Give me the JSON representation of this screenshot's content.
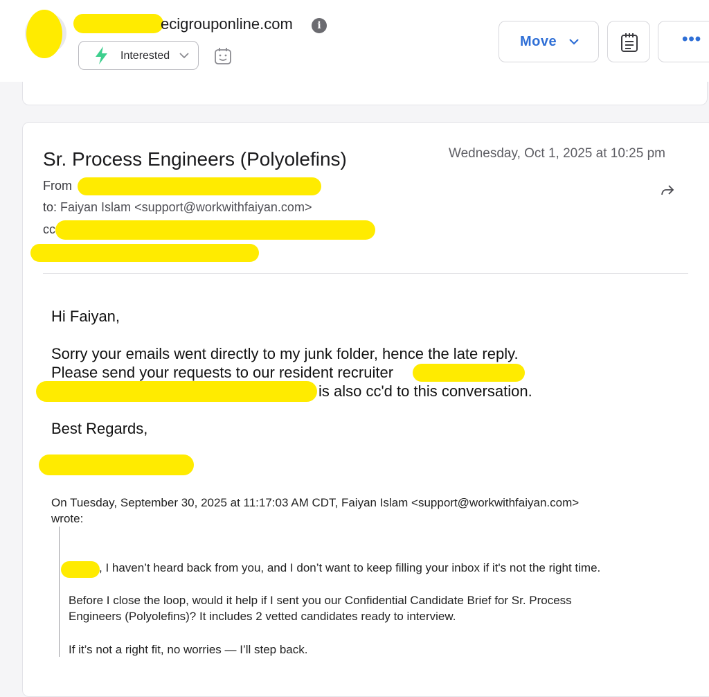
{
  "header": {
    "sender_domain": "ecigrouponline.com",
    "info_icon": "info-icon",
    "status_label": "Interested",
    "move_label": "Move",
    "more_label": "•••"
  },
  "email": {
    "subject": "Sr. Process Engineers (Polyolefins)",
    "date": "Wednesday, Oct 1, 2025 at 10:25 pm",
    "from_label": "From",
    "to_label": "to:",
    "to_value": "Faiyan Islam <support@workwithfaiyan.com>",
    "cc_label": "cc"
  },
  "body": {
    "greeting": "Hi Faiyan,",
    "line1": "Sorry your emails went directly to my junk folder, hence the late reply.",
    "line2": "Please send your requests to our resident recruiter",
    "line3_tail": "is also cc'd to this conversation.",
    "signoff": "Best Regards,"
  },
  "quote": {
    "header_line1": "On Tuesday, September 30, 2025 at 11:17:03 AM CDT, Faiyan Islam <support@workwithfaiyan.com>",
    "header_line2": "wrote:",
    "p1": ", I haven’t heard back from you, and I don’t want to keep filling your inbox if it's not the right time.",
    "p2_line1": "Before I close the loop, would it help if I sent you our Confidential Candidate Brief for Sr. Process",
    "p2_line2": "Engineers (Polyolefins)? It includes 2 vetted candidates ready to interview.",
    "p3": "If it’s not a right fit, no worries — I’ll step back."
  },
  "colors": {
    "accent": "#2f6fd6",
    "status_green": "#3ecf8e",
    "redaction": "#ffeb00"
  }
}
